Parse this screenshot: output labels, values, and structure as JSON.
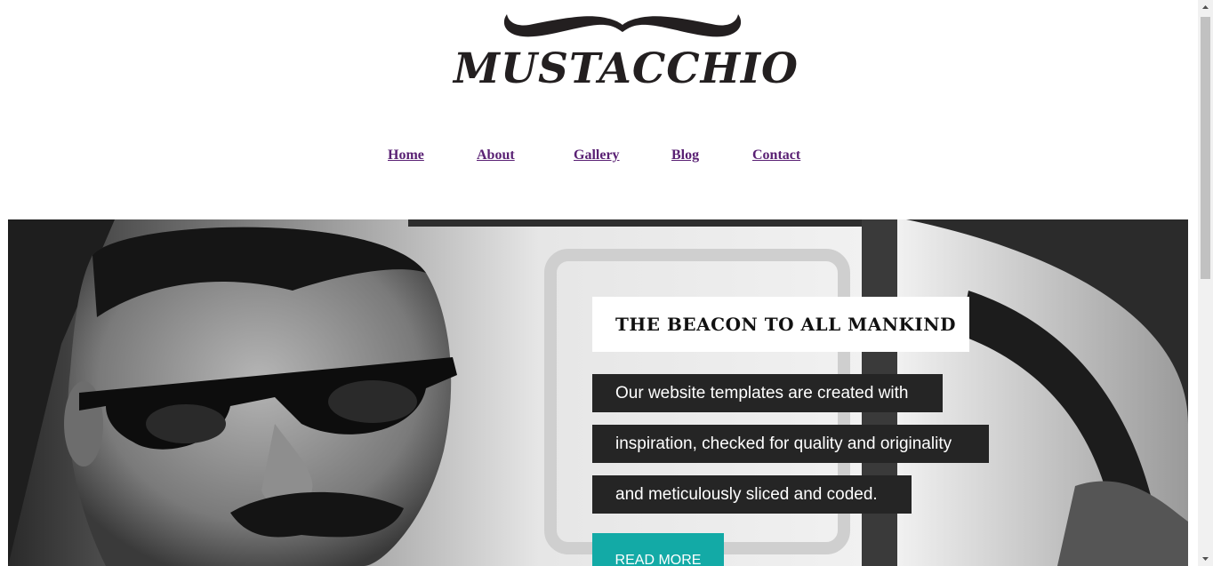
{
  "brand": {
    "logo_text": "MUSTACCHIO",
    "logo_icon": "mustache-icon"
  },
  "nav": {
    "items": [
      {
        "label": "Home"
      },
      {
        "label": "About"
      },
      {
        "label": "Gallery"
      },
      {
        "label": "Blog"
      },
      {
        "label": "Contact"
      }
    ]
  },
  "hero": {
    "image": "man-in-sunglasses-car-photo",
    "title": "THE BEACON TO ALL MANKIND",
    "lines": [
      "Our website templates are created with",
      "inspiration, checked for quality and originality",
      "and meticulously sliced and coded."
    ],
    "cta_label": "READ MORE"
  },
  "colors": {
    "nav_link": "#5a2174",
    "cta_bg": "#13aaa6",
    "text_box_bg": "#252525"
  }
}
